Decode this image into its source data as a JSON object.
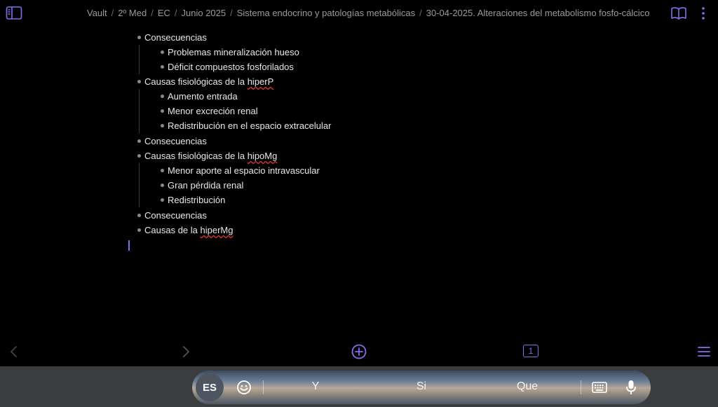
{
  "breadcrumb": [
    "Vault",
    "2º Med",
    "EC",
    "Junio 2025",
    "Sistema endocrino y patologías metabólicas",
    "30-04-2025. Alteraciones del metabolismo fosfo-cálcico"
  ],
  "outline": [
    {
      "text": "Consecuencias",
      "indent": 1
    },
    {
      "text": "Problemas mineralización hueso",
      "indent": 2
    },
    {
      "text": "Déficit compuestos fosforilados",
      "indent": 2
    },
    {
      "text": "Causas fisiológicas de la ",
      "flagged": "hiperP",
      "indent": 1
    },
    {
      "text": "Aumento entrada",
      "indent": 2
    },
    {
      "text": "Menor excreción renal",
      "indent": 2
    },
    {
      "text": "Redistribución en el espacio extracelular",
      "indent": 2
    },
    {
      "text": "Consecuencias",
      "indent": 1
    },
    {
      "text": "Causas fisiológicas de la ",
      "flagged": "hipoMg",
      "indent": 1
    },
    {
      "text": "Menor aporte al espacio intravascular",
      "indent": 2
    },
    {
      "text": "Gran pérdida renal",
      "indent": 2
    },
    {
      "text": "Redistribución",
      "indent": 2
    },
    {
      "text": "Consecuencias",
      "indent": 1
    },
    {
      "text": "Causas de la ",
      "flagged": "hiperMg",
      "indent": 1
    }
  ],
  "nav": {
    "tab_count": "1"
  },
  "keyboard": {
    "language": "ES",
    "suggestions": [
      "Y",
      "Si",
      "Que"
    ]
  },
  "colors": {
    "accent": "#8b6cf0",
    "spellcheck": "#e03a3a"
  }
}
